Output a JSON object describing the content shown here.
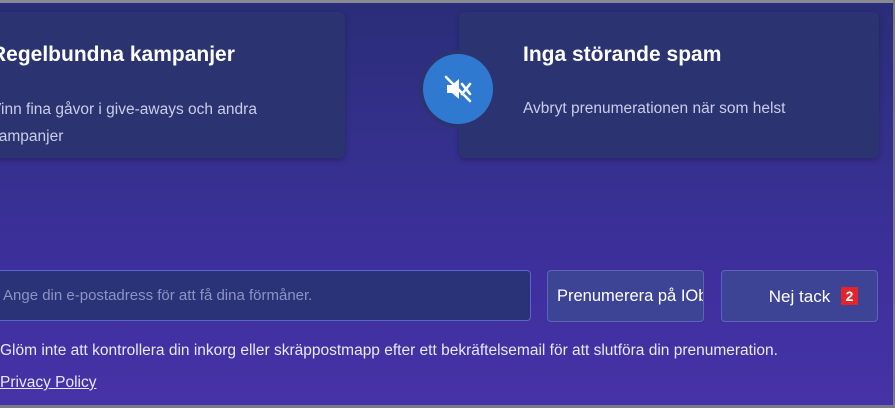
{
  "benefits": [
    {
      "title": "Regelbundna kampanjer",
      "desc": "Vinn fina gåvor i give-aways och andra kampanjer"
    },
    {
      "title": "Inga störande spam",
      "desc": "Avbryt prenumerationen när som helst",
      "icon": "mute-speaker-icon"
    }
  ],
  "form": {
    "email_placeholder": "Ange din e-postadress för att få dina förmåner.",
    "subscribe_label": "Prenumerera på IObits nyhetsbrev",
    "no_thanks_label": "Nej tack",
    "step_badge": "2"
  },
  "footer": {
    "note": "Glöm inte att kontrollera din inkorg eller skräppostmapp efter ett bekräftelsemail för att slutföra din prenumeration.",
    "privacy_link": "Privacy Policy"
  },
  "colors": {
    "background": "#34308c",
    "card": "#2b3470",
    "icon_circle": "#2f7ad0",
    "badge": "#e3242b"
  }
}
